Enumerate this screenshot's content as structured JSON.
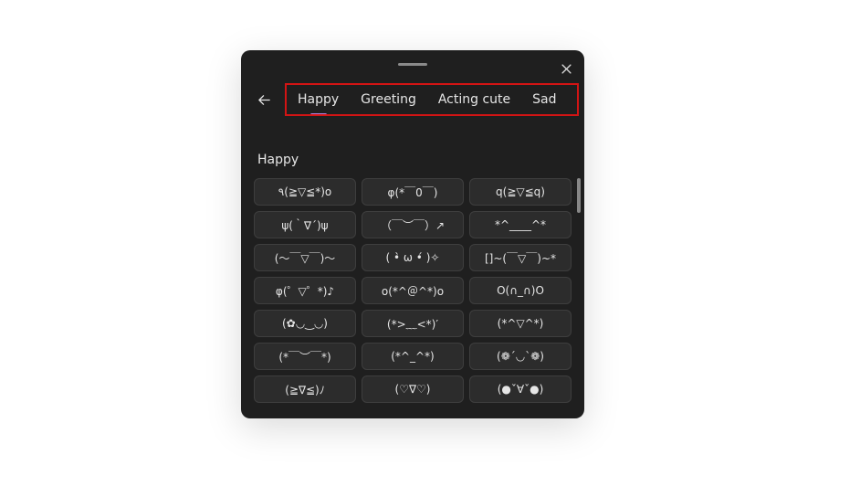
{
  "tabs": [
    {
      "label": "Happy",
      "active": true
    },
    {
      "label": "Greeting",
      "active": false
    },
    {
      "label": "Acting cute",
      "active": false
    },
    {
      "label": "Sad",
      "active": false
    }
  ],
  "section_title": "Happy",
  "kaomoji": [
    "٩(≧▽≦*)o",
    "φ(*￣0￣)",
    "q(≧▽≦q)",
    "ψ(｀∇´)ψ",
    "（￣︶￣）↗",
    "*^____^*",
    "(～￣▽￣)～",
    "( •̀ ω •́ )✧",
    "[]~(￣▽￣)~*",
    "φ(゜▽゜*)♪",
    "o(*^＠^*)o",
    "O(∩_∩)O",
    "(✿◡‿◡)",
    "(*>﹏<*)′",
    "(*^▽^*)",
    "(*￣︶￣*)",
    "(*^_^*)",
    "(❁´◡`❁)",
    "(≧∇≦)ﾉ",
    "(♡∇♡)",
    "(●ˇ∀ˇ●)"
  ]
}
